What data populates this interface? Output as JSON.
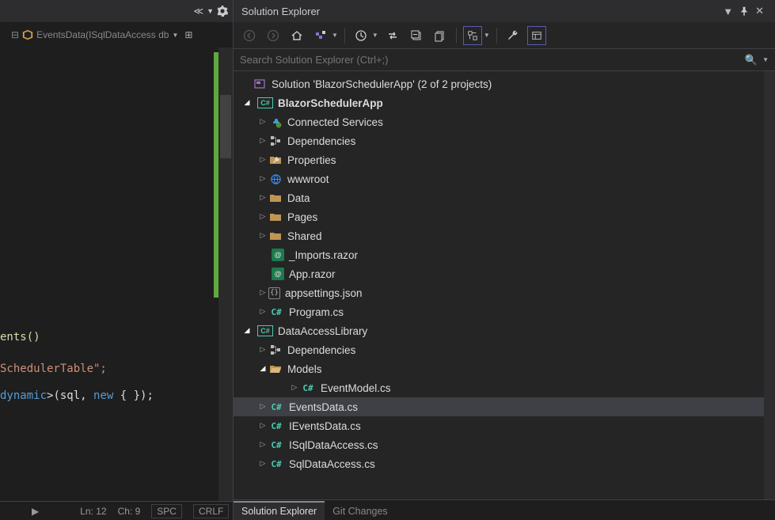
{
  "editor": {
    "tab_label": "EventsData(ISqlDataAccess db",
    "code_fn": "ents()",
    "code_str_line": "SchedulerTable\";",
    "code_generic_kw": "dynamic",
    "code_call": ">(sql, ",
    "code_new_kw": "new",
    "code_rest": " { });"
  },
  "status": {
    "ln": "Ln: 12",
    "ch": "Ch: 9",
    "spc": "SPC",
    "crlf": "CRLF"
  },
  "panel": {
    "title": "Solution Explorer",
    "search_placeholder": "Search Solution Explorer (Ctrl+;)"
  },
  "tree": {
    "solution": "Solution 'BlazorSchedulerApp' (2 of 2 projects)",
    "proj1": "BlazorSchedulerApp",
    "connected": "Connected Services",
    "deps": "Dependencies",
    "properties": "Properties",
    "wwwroot": "wwwroot",
    "data": "Data",
    "pages": "Pages",
    "shared": "Shared",
    "imports": "_Imports.razor",
    "app_razor": "App.razor",
    "appsettings": "appsettings.json",
    "program": "Program.cs",
    "proj2": "DataAccessLibrary",
    "deps2": "Dependencies",
    "models": "Models",
    "eventmodel": "EventModel.cs",
    "eventsdata": "EventsData.cs",
    "ieventsdata": "IEventsData.cs",
    "isqldata": "ISqlDataAccess.cs",
    "sqldata": "SqlDataAccess.cs"
  },
  "bottom_tabs": {
    "se": "Solution Explorer",
    "git": "Git Changes"
  }
}
